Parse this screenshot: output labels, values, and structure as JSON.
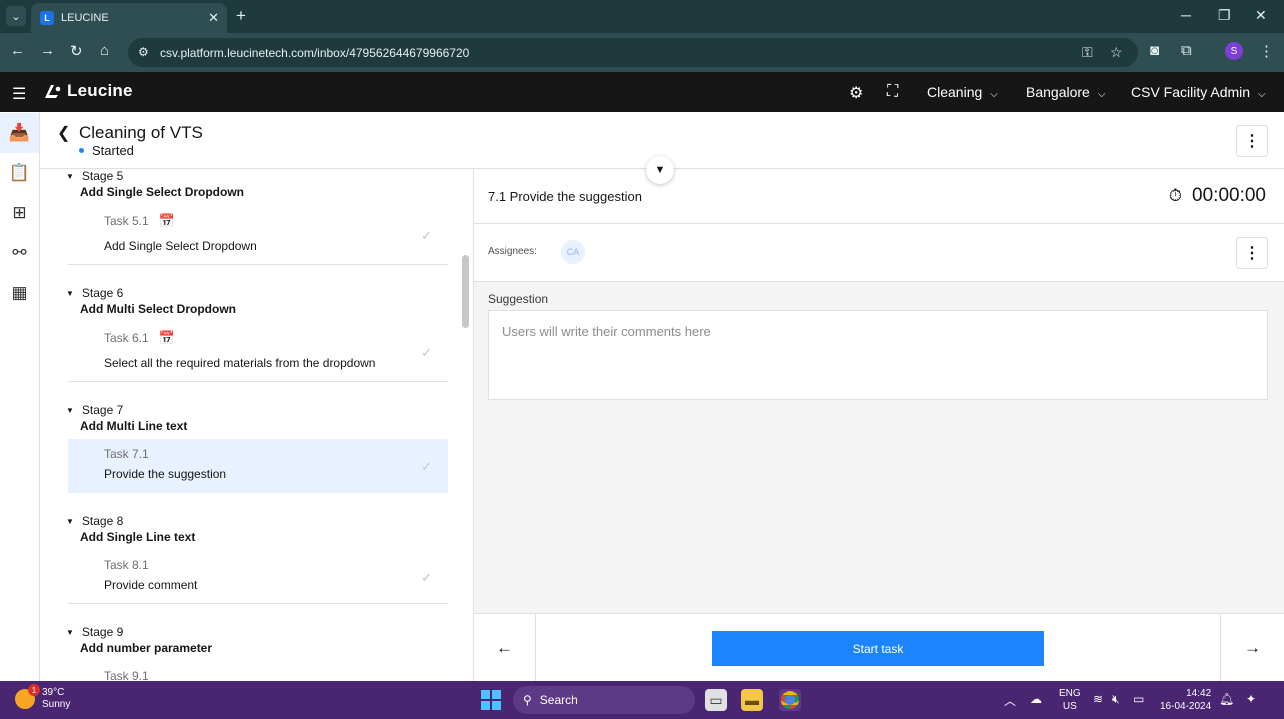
{
  "browser": {
    "tab_title": "LEUCINE",
    "url": "csv.platform.leucinetech.com/inbox/479562644679966720",
    "profile_initial": "S"
  },
  "appbar": {
    "brand": "Leucine",
    "use_case": "Cleaning",
    "facility": "Bangalore",
    "role": "CSV Facility Admin"
  },
  "page": {
    "title": "Cleaning of VTS",
    "status": "Started"
  },
  "stages": [
    {
      "stage": "Stage 5",
      "name": "Add Single Select Dropdown",
      "task_id": "Task 5.1",
      "task_name": "Add Single Select Dropdown",
      "has_schedule": true,
      "selected": false
    },
    {
      "stage": "Stage 6",
      "name": "Add Multi Select Dropdown",
      "task_id": "Task 6.1",
      "task_name": "Select all the required materials from the dropdown",
      "has_schedule": true,
      "selected": false
    },
    {
      "stage": "Stage 7",
      "name": "Add Multi Line text",
      "task_id": "Task 7.1",
      "task_name": "Provide the suggestion",
      "has_schedule": false,
      "selected": true
    },
    {
      "stage": "Stage 8",
      "name": "Add Single Line text",
      "task_id": "Task 8.1",
      "task_name": "Provide comment",
      "has_schedule": false,
      "selected": false
    },
    {
      "stage": "Stage 9",
      "name": "Add number parameter",
      "task_id": "Task 9.1",
      "task_name": "",
      "has_schedule": false,
      "selected": false
    }
  ],
  "task_panel": {
    "title": "7.1 Provide the suggestion",
    "timer": "00:00:00",
    "assignees_label": "Assignees:",
    "assignee_initials": "CA",
    "field_label": "Suggestion",
    "field_placeholder": "Users will write their comments here",
    "start_button": "Start task"
  },
  "taskbar": {
    "temperature": "39°C",
    "condition": "Sunny",
    "weather_badge": "1",
    "search_label": "Search",
    "lang_line1": "ENG",
    "lang_line2": "US",
    "time": "14:42",
    "date": "16-04-2024"
  },
  "colors": {
    "accent": "#1d84ff",
    "appbar_bg": "#161616",
    "selected_task_bg": "#e7f1ff",
    "taskbar_bg": "#4a2572"
  }
}
